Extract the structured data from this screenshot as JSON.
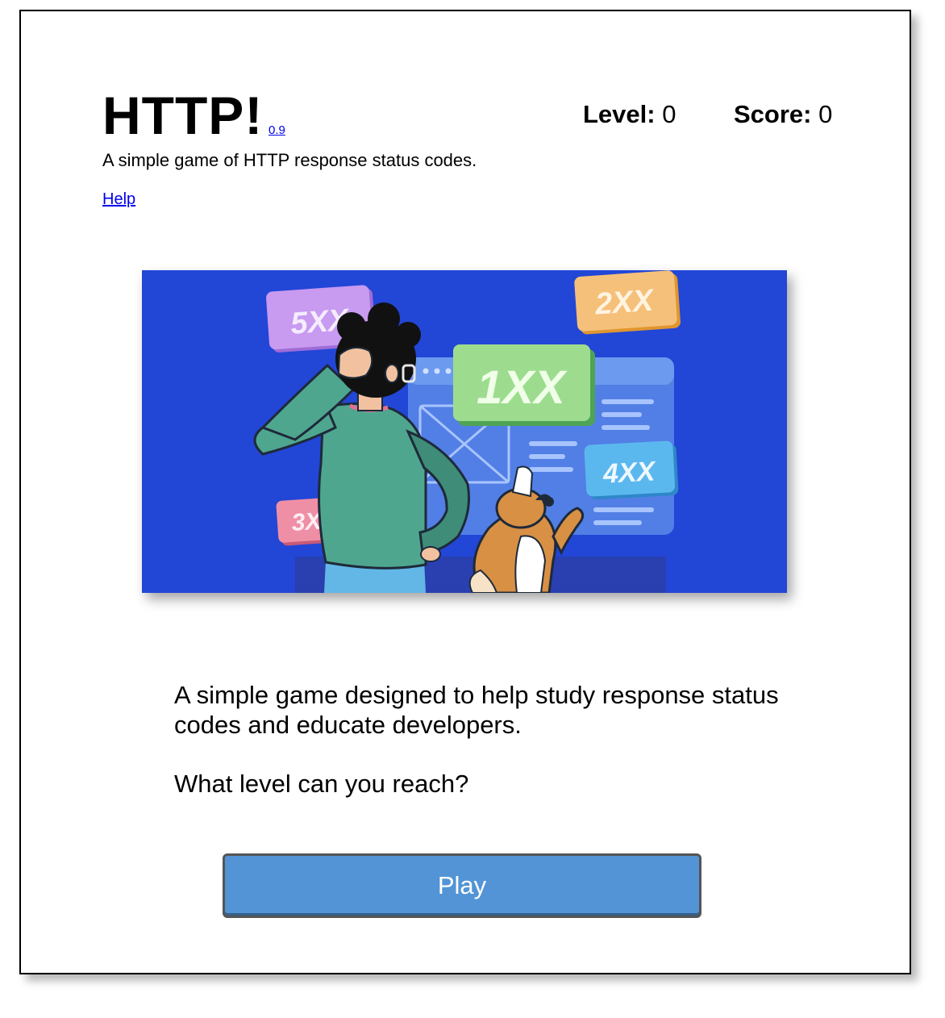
{
  "header": {
    "title": "HTTP!",
    "version": "0.9",
    "subtitle": "A simple game of HTTP response status codes.",
    "help_label": "Help"
  },
  "stats": {
    "level_label": "Level:",
    "level_value": "0",
    "score_label": "Score:",
    "score_value": "0"
  },
  "hero": {
    "cards": {
      "c1": "1XX",
      "c2": "2XX",
      "c3": "3X",
      "c4": "4XX",
      "c5": "5XX"
    },
    "colors": {
      "background": "#2246d6",
      "card_1xx": "#9ddc8f",
      "card_2xx": "#f5c07a",
      "card_3xx": "#ef8fa6",
      "card_4xx": "#5bb8ee",
      "card_5xx": "#c89af0"
    }
  },
  "main": {
    "description": "A simple game designed to help study response status codes and educate developers.",
    "question": "What level can you reach?"
  },
  "play_button": {
    "label": "Play",
    "color": "#5294d5"
  }
}
